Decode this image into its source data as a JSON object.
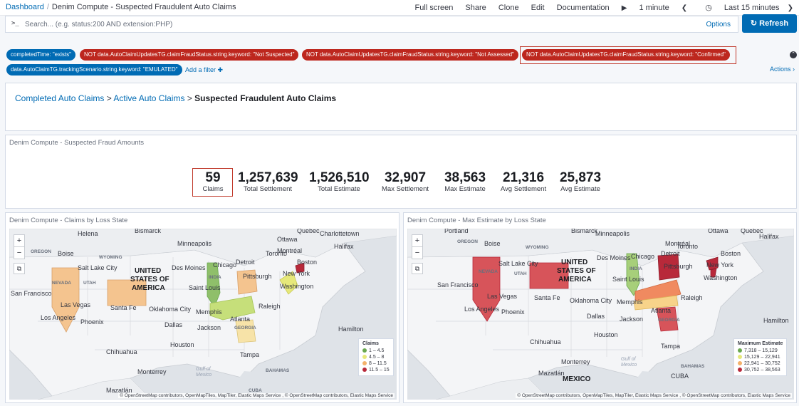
{
  "breadcrumb": {
    "root": "Dashboard",
    "separator": "/",
    "current": "Denim Compute - Suspected Fraudulent Auto Claims"
  },
  "header_actions": {
    "full_screen": "Full screen",
    "share": "Share",
    "clone": "Clone",
    "edit": "Edit",
    "documentation": "Documentation",
    "interval": "1 minute",
    "time_range": "Last 15 minutes"
  },
  "search": {
    "prompt": ">_",
    "placeholder": "Search... (e.g. status:200 AND extension:PHP)",
    "options": "Options",
    "refresh": "Refresh"
  },
  "filters": [
    {
      "label": "completedTime: \"exists\"",
      "color": "blue"
    },
    {
      "label": "NOT data.AutoClaimUpdatesTG.claimFraudStatus.string.keyword: \"Not Suspected\"",
      "color": "red"
    },
    {
      "label": "NOT data.AutoClaimUpdatesTG.claimFraudStatus.string.keyword: \"Not Assessed\"",
      "color": "red"
    },
    {
      "label": "NOT data.AutoClaimUpdatesTG.claimFraudStatus.string.keyword: \"Confirmed\"",
      "color": "red"
    },
    {
      "label": "data.AutoClaimTG.trackingScenario.string.keyword: \"EMULATED\"",
      "color": "blue"
    }
  ],
  "add_filter": "Add a filter",
  "actions_link": "Actions",
  "nav_panel": {
    "link1": "Completed Auto Claims",
    "sep": ">",
    "link2": "Active Auto Claims",
    "current": "Suspected Fraudulent Auto Claims"
  },
  "metrics_panel": {
    "title": "Denim Compute - Suspected Fraud Amounts",
    "metrics": [
      {
        "value": "59",
        "label": "Claims"
      },
      {
        "value": "1,257,639",
        "label": "Total Settlement"
      },
      {
        "value": "1,526,510",
        "label": "Total Estimate"
      },
      {
        "value": "32,907",
        "label": "Max Settlement"
      },
      {
        "value": "38,563",
        "label": "Max Estimate"
      },
      {
        "value": "21,316",
        "label": "Avg Settlement"
      },
      {
        "value": "25,873",
        "label": "Avg Estimate"
      }
    ]
  },
  "map_left": {
    "title": "Denim Compute - Claims by Loss State",
    "legend_title": "Claims",
    "legend": [
      {
        "label": "1 – 4.5",
        "color": "#6aa84f"
      },
      {
        "label": "4.5 – 8",
        "color": "#e6e87a"
      },
      {
        "label": "8 – 11.5",
        "color": "#f4b26b"
      },
      {
        "label": "11.5 – 15",
        "color": "#b8293a"
      }
    ]
  },
  "map_right": {
    "title": "Denim Compute - Max Estimate by Loss State",
    "legend_title": "Maximum Estimate",
    "legend": [
      {
        "label": "7,318 – 15,129",
        "color": "#6aa84f"
      },
      {
        "label": "15,129 – 22,941",
        "color": "#e6e87a"
      },
      {
        "label": "22,941 – 30,752",
        "color": "#f4b26b"
      },
      {
        "label": "30,752 – 38,563",
        "color": "#b8293a"
      }
    ]
  },
  "map_labels": {
    "helena": "Helena",
    "bismarck": "Bismarck",
    "quebec": "Quebec",
    "charlottetown": "Charlottetown",
    "minneapolis": "Minneapolis",
    "ottawa": "Ottawa",
    "halifax": "Halifax",
    "montreal": "Montréal",
    "portland": "Portland",
    "oregon": "OREGON",
    "boise": "Boise",
    "wyoming": "WYOMING",
    "slc": "Salt Lake City",
    "utah": "UTAH",
    "nevada": "NEVADA",
    "usa1": "UNITED",
    "usa2": "STATES OF",
    "usa3": "AMERICA",
    "chicago": "Chicago",
    "detroit": "Detroit",
    "desmoines": "Des Moines",
    "toronto": "Toronto",
    "boston": "Boston",
    "newyork": "New York",
    "pittsburgh": "Pittsburgh",
    "washington": "Washington",
    "sanfrancisco": "San Francisco",
    "saintlouis": "Saint Louis",
    "lasvegas": "Las Vegas",
    "santafe": "Santa Fe",
    "okcity": "Oklahoma City",
    "memphis": "Memphis",
    "raleigh": "Raleigh",
    "losangeles": "Los Angeles",
    "phoenix": "Phoenix",
    "dallas": "Dallas",
    "jackson": "Jackson",
    "atlanta": "Atlanta",
    "georgia": "GEORGIA",
    "hamilton": "Hamilton",
    "houston": "Houston",
    "chihuahua": "Chihuahua",
    "tampa": "Tampa",
    "monterrey": "Monterrey",
    "mazatlan": "Mazatlán",
    "cuba": "CUBA",
    "bahamas": "BAHAMAS",
    "mexico": "MEXICO",
    "indiana": "INDIA",
    "gulf1": "Gulf of",
    "gulf2": "Mexico"
  },
  "attribution": "© OpenStreetMap contributors, OpenMapTiles, MapTiler, Elastic Maps Service , © OpenStreetMap contributors, Elastic Maps Service"
}
